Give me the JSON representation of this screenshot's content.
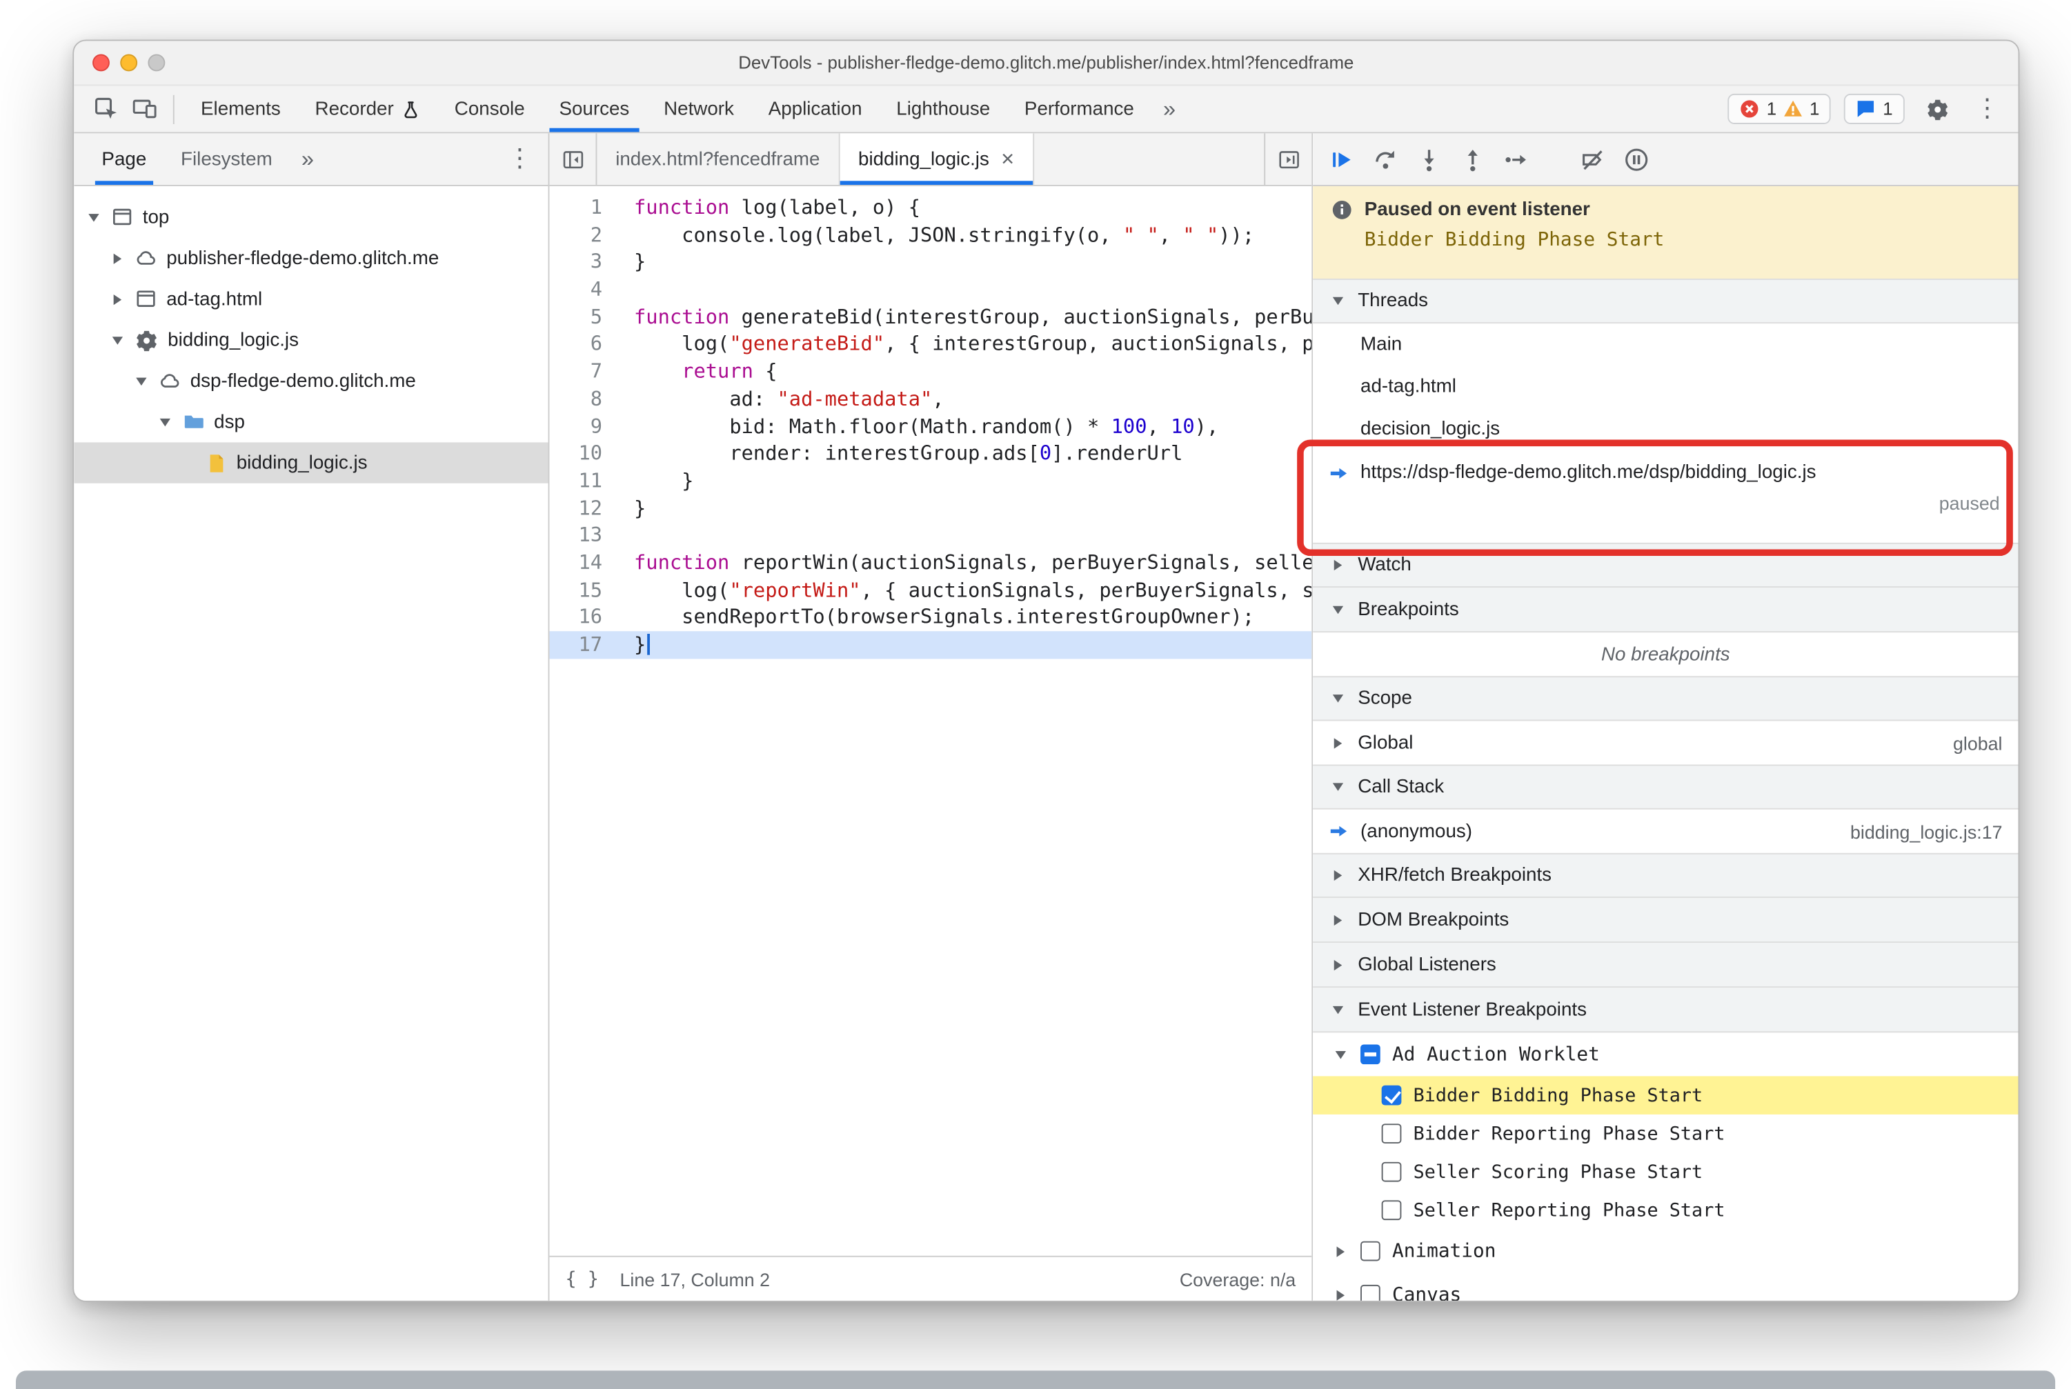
{
  "window": {
    "title": "DevTools - publisher-fledge-demo.glitch.me/publisher/index.html?fencedframe"
  },
  "toolbar": {
    "tabs": [
      {
        "label": "Elements"
      },
      {
        "label": "Recorder",
        "badge": true
      },
      {
        "label": "Console"
      },
      {
        "label": "Sources",
        "selected": true
      },
      {
        "label": "Network"
      },
      {
        "label": "Application"
      },
      {
        "label": "Lighthouse"
      },
      {
        "label": "Performance"
      }
    ],
    "more_label": "»",
    "error_count": "1",
    "warning_count": "1",
    "issues_count": "1"
  },
  "navigator": {
    "tabs": [
      {
        "label": "Page",
        "selected": true
      },
      {
        "label": "Files",
        "full_label": "Filesystem"
      }
    ],
    "more_label": "»",
    "tree": [
      {
        "label": "top",
        "icon": "frame",
        "depth": 0,
        "expander": "down"
      },
      {
        "label": "publisher-fledge-demo.glitch.me",
        "icon": "cloud",
        "depth": 1,
        "expander": "right"
      },
      {
        "label": "ad-tag.html",
        "icon": "frame",
        "depth": 1,
        "expander": "right"
      },
      {
        "label": "bidding_logic.js",
        "icon": "gear",
        "depth": 1,
        "expander": "down"
      },
      {
        "label": "dsp-fledge-demo.glitch.me",
        "icon": "cloud",
        "depth": 2,
        "expander": "down"
      },
      {
        "label": "dsp",
        "icon": "folder",
        "depth": 3,
        "expander": "down"
      },
      {
        "label": "bidding_logic.js",
        "icon": "file",
        "depth": 4,
        "expander": "none",
        "selected": true
      }
    ]
  },
  "editor": {
    "tabs": [
      {
        "label": "index.html?fencedframe"
      },
      {
        "label": "bidding_logic.js",
        "active": true,
        "close": "×"
      }
    ],
    "active_line": 17,
    "code": [
      {
        "num": 1,
        "segments": [
          [
            "kw",
            "function"
          ],
          [
            "pl",
            " log(label, o) {"
          ]
        ]
      },
      {
        "num": 2,
        "segments": [
          [
            "pl",
            "    console.log(label, JSON.stringify(o, "
          ],
          [
            "str",
            "\" \""
          ],
          [
            "pl",
            ", "
          ],
          [
            "str",
            "\" \""
          ],
          [
            "pl",
            "));"
          ]
        ]
      },
      {
        "num": 3,
        "segments": [
          [
            "pl",
            "}"
          ]
        ]
      },
      {
        "num": 4,
        "segments": []
      },
      {
        "num": 5,
        "segments": [
          [
            "kw",
            "function"
          ],
          [
            "pl",
            " generateBid(interestGroup, auctionSignals, perBuyerSignals, trustedBiddingSignals, browserSignals) {"
          ]
        ]
      },
      {
        "num": 6,
        "segments": [
          [
            "pl",
            "    log("
          ],
          [
            "str",
            "\"generateBid\""
          ],
          [
            "pl",
            ", { interestGroup, auctionSignals, perBuyerSignals, trustedBiddingSignals, browserSignals });"
          ]
        ]
      },
      {
        "num": 7,
        "segments": [
          [
            "pl",
            "    "
          ],
          [
            "kw",
            "return"
          ],
          [
            "pl",
            " {"
          ]
        ]
      },
      {
        "num": 8,
        "segments": [
          [
            "pl",
            "        ad: "
          ],
          [
            "str",
            "\"ad-metadata\""
          ],
          [
            "pl",
            ","
          ]
        ]
      },
      {
        "num": 9,
        "segments": [
          [
            "pl",
            "        bid: Math.floor(Math.random() * "
          ],
          [
            "num",
            "100"
          ],
          [
            "pl",
            ", "
          ],
          [
            "num",
            "10"
          ],
          [
            "pl",
            "),"
          ]
        ]
      },
      {
        "num": 10,
        "segments": [
          [
            "pl",
            "        render: interestGroup.ads["
          ],
          [
            "num",
            "0"
          ],
          [
            "pl",
            "].renderUrl"
          ]
        ]
      },
      {
        "num": 11,
        "segments": [
          [
            "pl",
            "    }"
          ]
        ]
      },
      {
        "num": 12,
        "segments": [
          [
            "pl",
            "}"
          ]
        ]
      },
      {
        "num": 13,
        "segments": []
      },
      {
        "num": 14,
        "segments": [
          [
            "kw",
            "function"
          ],
          [
            "pl",
            " reportWin(auctionSignals, perBuyerSignals, sellerSignals, browserSignals) {"
          ]
        ]
      },
      {
        "num": 15,
        "segments": [
          [
            "pl",
            "    log("
          ],
          [
            "str",
            "\"reportWin\""
          ],
          [
            "pl",
            ", { auctionSignals, perBuyerSignals, sellerSignals, browserSignals });"
          ]
        ]
      },
      {
        "num": 16,
        "segments": [
          [
            "pl",
            "    sendReportTo(browserSignals.interestGroupOwner);"
          ]
        ]
      },
      {
        "num": 17,
        "segments": [
          [
            "pl",
            "}"
          ]
        ]
      }
    ],
    "status_left": "Line 17, Column 2",
    "status_right": "Coverage: n/a",
    "pretty_print_label": "{ }"
  },
  "debugger": {
    "paused": {
      "title": "Paused on event listener",
      "subtitle": "Bidder Bidding Phase Start"
    },
    "threads": {
      "title": "Threads",
      "items": [
        {
          "label": "Main"
        },
        {
          "label": "ad-tag.html"
        },
        {
          "label": "decision_logic.js"
        },
        {
          "label": "https://dsp-fledge-demo.glitch.me/dsp/bidding_logic.js",
          "active": true,
          "status": "paused"
        }
      ]
    },
    "watch": {
      "title": "Watch"
    },
    "breakpoints": {
      "title": "Breakpoints",
      "empty": "No breakpoints"
    },
    "scope": {
      "title": "Scope",
      "rows": [
        {
          "label": "Global",
          "value": "global"
        }
      ]
    },
    "call_stack": {
      "title": "Call Stack",
      "frames": [
        {
          "label": "(anonymous)",
          "location": "bidding_logic.js:17",
          "active": true
        }
      ]
    },
    "xhr_fetch": {
      "title": "XHR/fetch Breakpoints"
    },
    "dom": {
      "title": "DOM Breakpoints"
    },
    "global_listeners": {
      "title": "Global Listeners"
    },
    "event_listener_breakpoints": {
      "title": "Event Listener Breakpoints",
      "categories": [
        {
          "label": "Ad Auction Worklet",
          "checkbox": "indeterminate",
          "expander": "down",
          "children": [
            {
              "label": "Bidder Bidding Phase Start",
              "checked": true,
              "highlighted": true
            },
            {
              "label": "Bidder Reporting Phase Start",
              "checked": false
            },
            {
              "label": "Seller Scoring Phase Start",
              "checked": false
            },
            {
              "label": "Seller Reporting Phase Start",
              "checked": false
            }
          ]
        },
        {
          "label": "Animation",
          "checkbox": "unchecked",
          "expander": "right",
          "children": []
        },
        {
          "label": "Canvas",
          "checkbox": "unchecked",
          "expander": "right",
          "children": []
        }
      ]
    },
    "annotation_color": "#e3312a"
  },
  "icons": {
    "inspect-icon": "cursor-in-square",
    "device-toolbar-icon": "phone-and-screen",
    "recorder-experiment-icon": "beaker",
    "error-icon": "red-circle-x",
    "warning-icon": "yellow-triangle",
    "issues-icon": "blue-speech-bubble",
    "settings-gear-icon": "gear",
    "kebab-menu-icon": "vertical-dots",
    "frame-icon": "page-frame",
    "cloud-icon": "cloud-outline",
    "gear-icon": "gear",
    "folder-icon": "blue-folder",
    "file-icon": "yellow-file",
    "hide-navigator-icon": "panel-collapse-left",
    "navigate-forward-icon": "panel-play-right",
    "resume-icon": "blue-play",
    "step-over-icon": "arc-arrow-over-dot",
    "step-into-icon": "down-arrow-to-dot",
    "step-out-icon": "up-arrow-from-dot",
    "step-icon": "right-arrow-from-dot",
    "deactivate-breakpoints-icon": "slashed-breakpoint",
    "pause-on-exceptions-icon": "pause-in-circle",
    "info-icon": "info-circle",
    "execution-arrow-icon": "blue-block-arrow"
  },
  "colors": {
    "accent": "#1a73e8",
    "paused_banner": "#fbf1ce",
    "highlight_yellow": "#fff394",
    "selection_gray": "#dcdcdc",
    "keyword": "#aa0d91",
    "string": "#c41a16",
    "number": "#1c00cf"
  }
}
